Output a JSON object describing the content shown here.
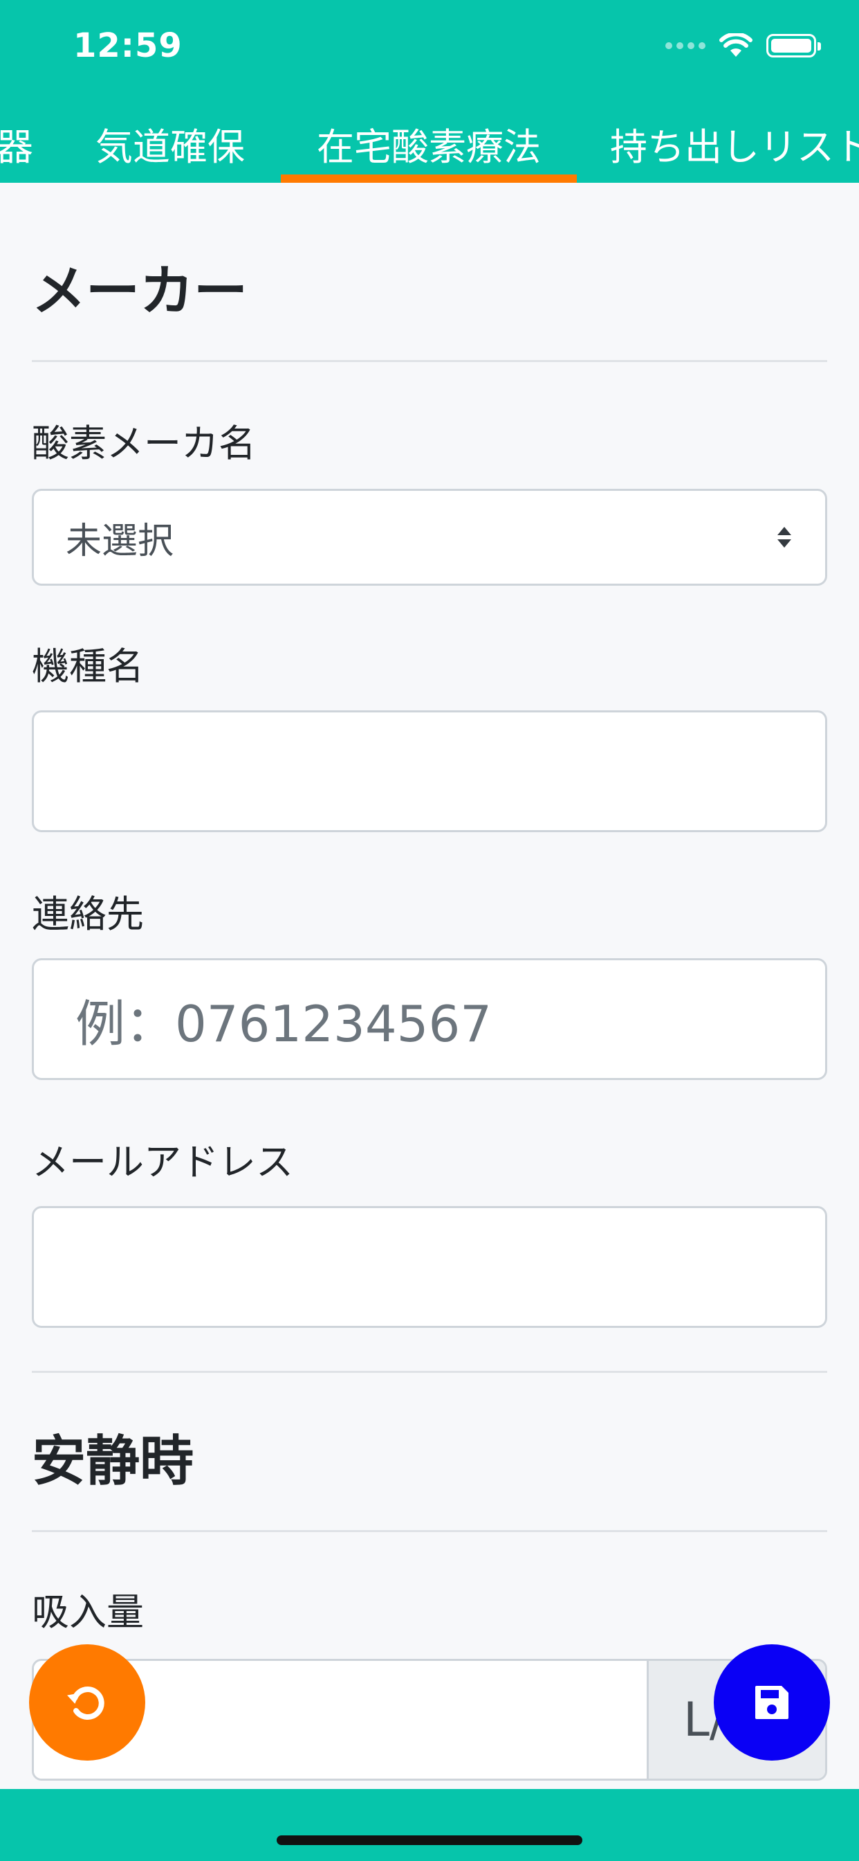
{
  "status_bar": {
    "time": "12:59"
  },
  "tabs": [
    {
      "label": "器",
      "active": false
    },
    {
      "label": "気道確保",
      "active": false
    },
    {
      "label": "在宅酸素療法",
      "active": true
    },
    {
      "label": "持ち出しリスト",
      "active": false
    }
  ],
  "sections": {
    "maker": {
      "title": "メーカー",
      "oxygen_maker_label": "酸素メーカ名",
      "oxygen_maker_value": "未選択",
      "model_label": "機種名",
      "model_value": "",
      "contact_label": "連絡先",
      "contact_placeholder": "例：0761234567",
      "email_label": "メールアドレス",
      "email_value": ""
    },
    "at_rest": {
      "title": "安静時",
      "intake_label": "吸入量",
      "intake_value": "",
      "intake_unit": "L/"
    }
  },
  "icons": {
    "undo": "undo-icon",
    "save": "save-icon",
    "wifi": "wifi-icon",
    "battery": "battery-icon"
  },
  "colors": {
    "header": "#06c5ab",
    "tab_indicator": "#ff7a00",
    "undo_fab": "#ff7a00",
    "save_fab": "#0a00f5"
  }
}
